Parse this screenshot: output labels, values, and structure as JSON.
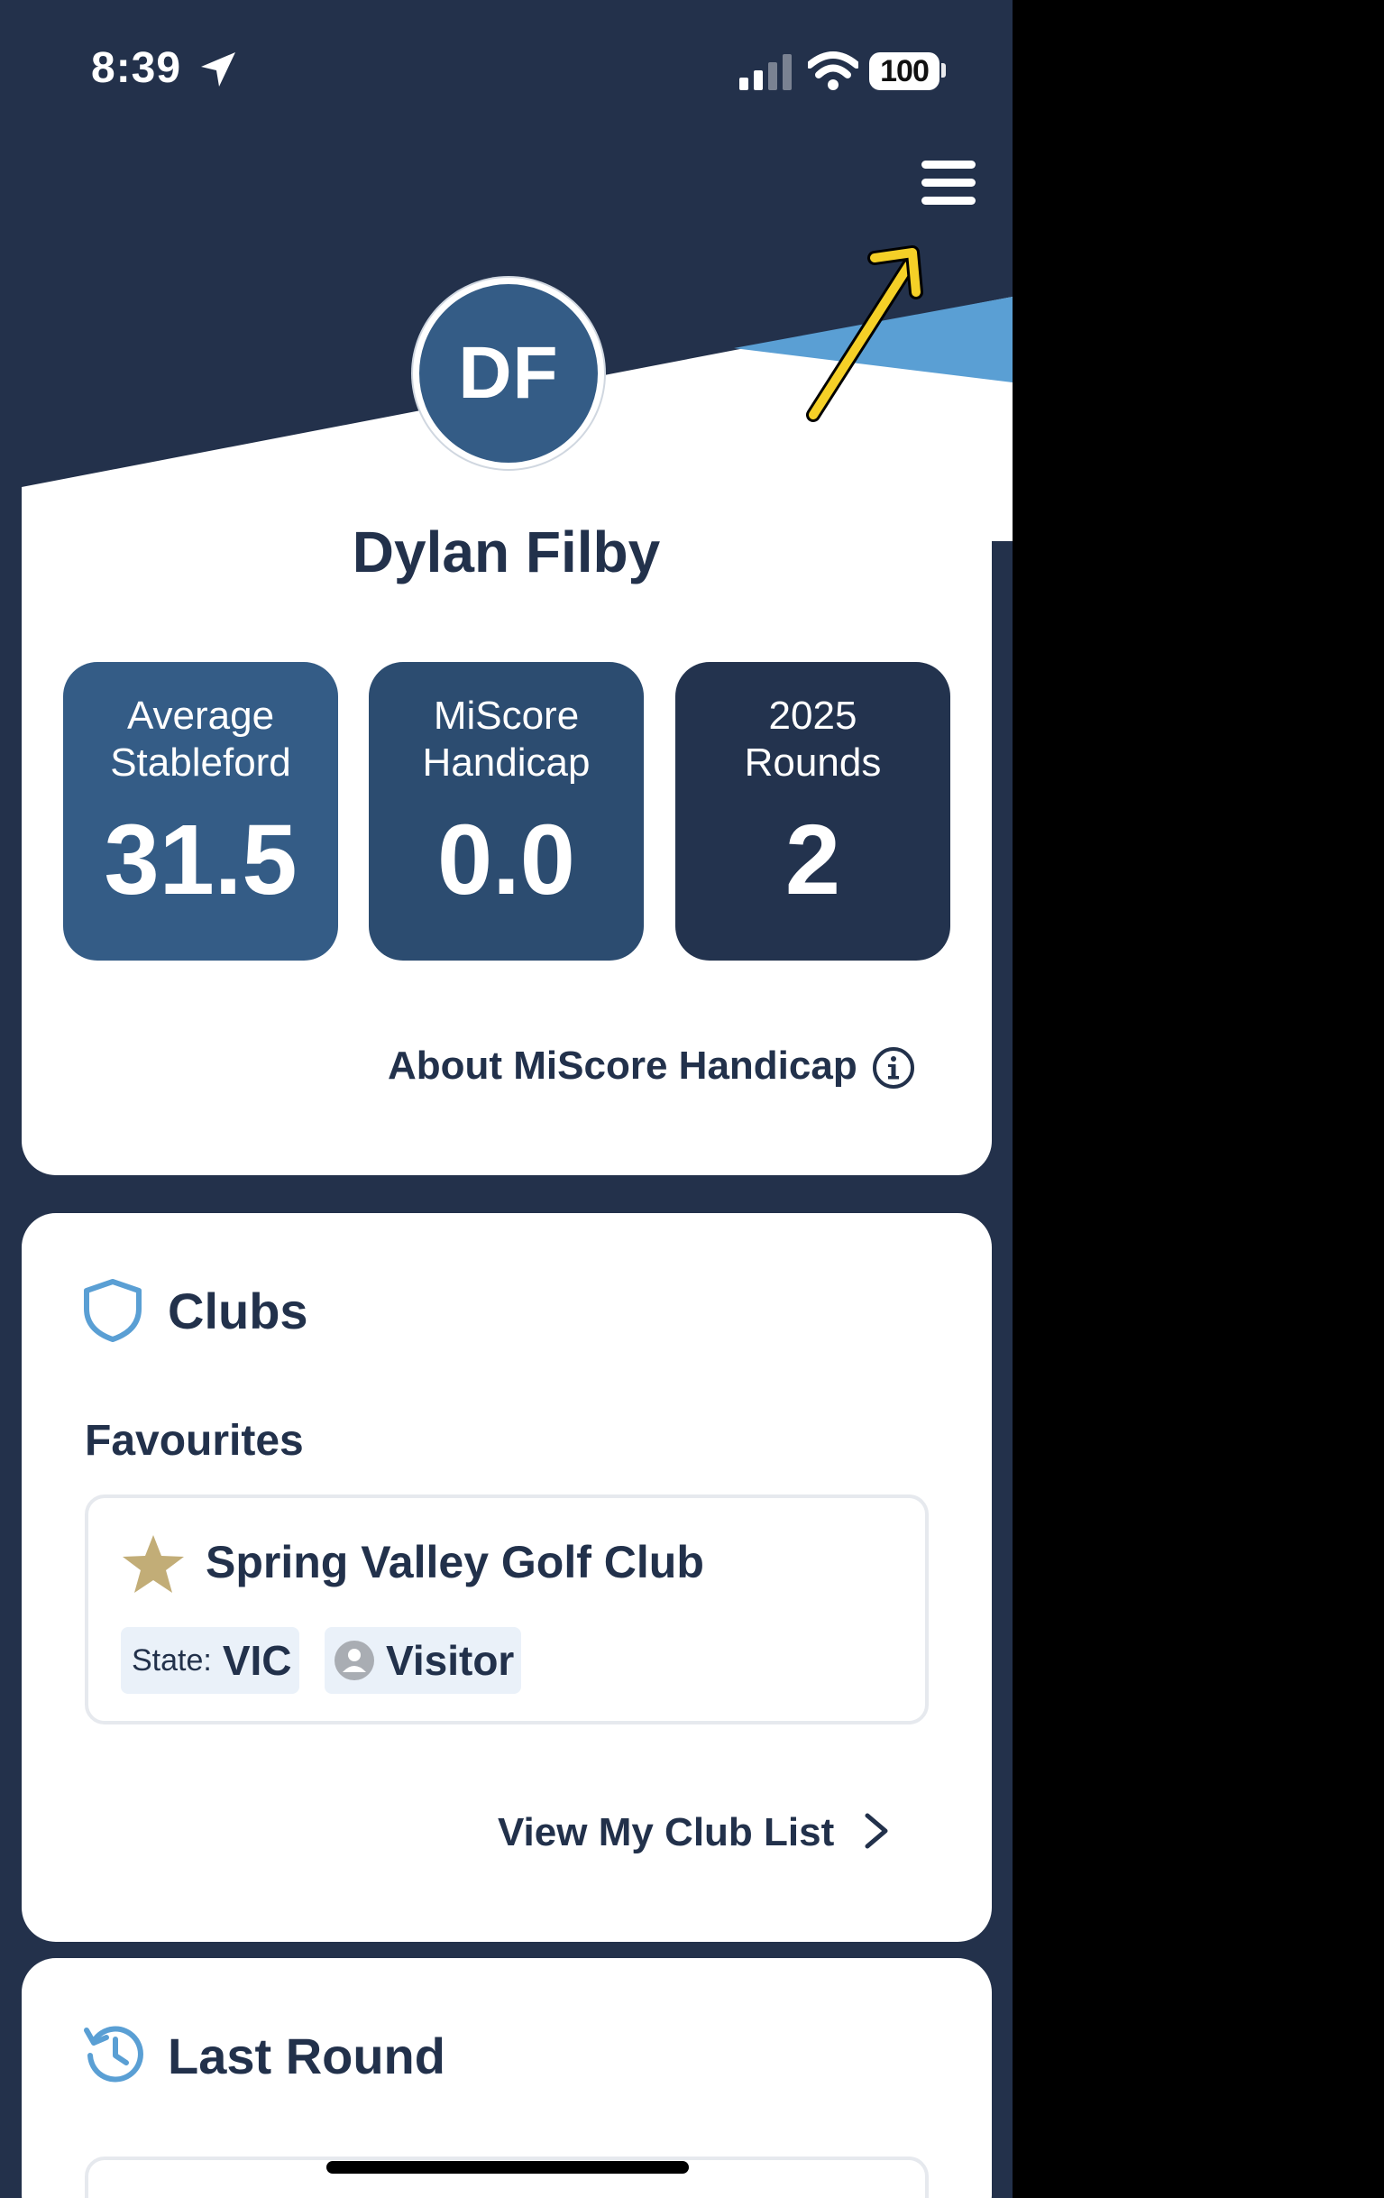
{
  "status_bar": {
    "time": "8:39",
    "battery": "100"
  },
  "profile": {
    "initials": "DF",
    "name": "Dylan Filby",
    "stats": [
      {
        "label_line1": "Average",
        "label_line2": "Stableford",
        "value": "31.5",
        "color": "#345c86"
      },
      {
        "label_line1": "MiScore",
        "label_line2": "Handicap",
        "value": "0.0",
        "color": "#2c4c70"
      },
      {
        "label_line1": "2025",
        "label_line2": "Rounds",
        "value": "2",
        "color": "#23334e"
      }
    ],
    "about_link": "About MiScore Handicap"
  },
  "clubs": {
    "title": "Clubs",
    "favourites_label": "Favourites",
    "favourite_club": {
      "name": "Spring Valley Golf Club",
      "state_label": "State:",
      "state_value": "VIC",
      "membership": "Visitor"
    },
    "view_list_link": "View My Club List"
  },
  "last_round": {
    "title": "Last Round"
  },
  "colors": {
    "header_dark": "#23314b",
    "accent_blue": "#5a9fd4",
    "star_gold": "#c2ad77",
    "annotation_arrow": "#f5d027"
  }
}
